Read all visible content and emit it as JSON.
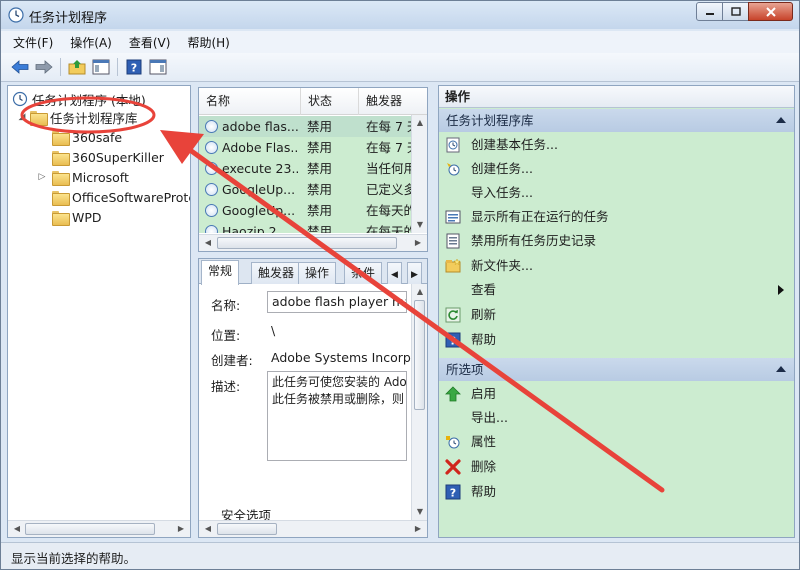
{
  "window": {
    "title": "任务计划程序"
  },
  "menu": [
    "文件(F)",
    "操作(A)",
    "查看(V)",
    "帮助(H)"
  ],
  "tree": {
    "root": "任务计划程序 (本地)",
    "library": "任务计划程序库",
    "children": [
      "360safe",
      "360SuperKiller",
      "Microsoft",
      "OfficeSoftwareProte",
      "WPD"
    ]
  },
  "task_list": {
    "columns": [
      "名称",
      "状态",
      "触发器"
    ],
    "rows": [
      {
        "name": "adobe flas...",
        "status": "禁用",
        "trigger": "在每 7 天"
      },
      {
        "name": "Adobe Flas...",
        "status": "禁用",
        "trigger": "在每 7 天"
      },
      {
        "name": "execute 23...",
        "status": "禁用",
        "trigger": "当任何用"
      },
      {
        "name": "GoogleUp...",
        "status": "禁用",
        "trigger": "已定义多"
      },
      {
        "name": "GoogleUp...",
        "status": "禁用",
        "trigger": "在每天的"
      },
      {
        "name": "Haozip 2...",
        "status": "禁用",
        "trigger": "在每天的"
      }
    ]
  },
  "details": {
    "tabs": [
      "常规",
      "触发器",
      "操作",
      "条件"
    ],
    "name_label": "名称:",
    "name_value": "adobe flash player mai",
    "location_label": "位置:",
    "location_value": "\\",
    "author_label": "创建者:",
    "author_value": "Adobe Systems Incorpo",
    "desc_label": "描述:",
    "desc_lines": [
      "此任务可使您安装的 Ado",
      "此任务被禁用或删除，则"
    ],
    "security_label": "安全选项"
  },
  "actions": {
    "title": "操作",
    "section1": "任务计划程序库",
    "items1": [
      "创建基本任务...",
      "创建任务...",
      "导入任务...",
      "显示所有正在运行的任务",
      "禁用所有任务历史记录",
      "新文件夹...",
      "查看",
      "刷新",
      "帮助"
    ],
    "section2": "所选项",
    "items2": [
      "启用",
      "导出...",
      "属性",
      "删除",
      "帮助"
    ]
  },
  "status": "显示当前选择的帮助。",
  "colors": {
    "highlight": "#ccecd0",
    "annotation": "#e8433a"
  }
}
